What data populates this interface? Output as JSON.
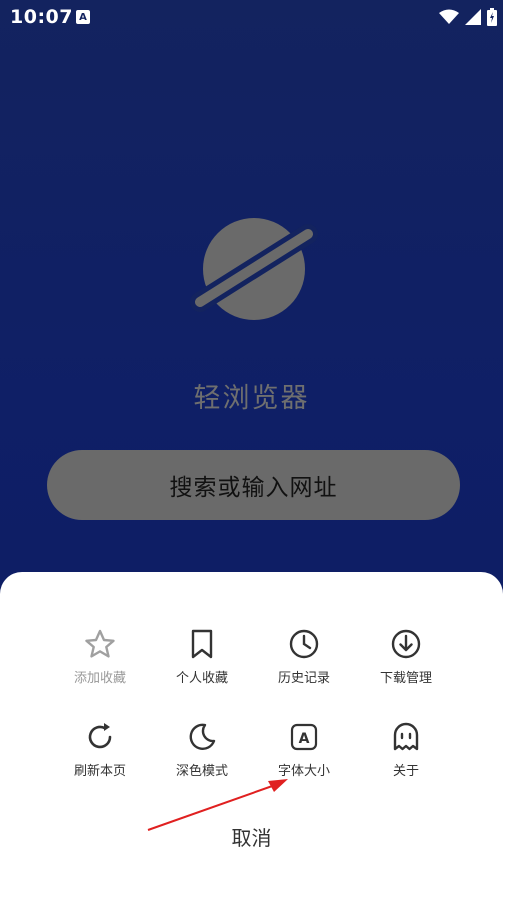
{
  "status_bar": {
    "time": "10:07",
    "notification_glyph": "A"
  },
  "app": {
    "name": "轻浏览器"
  },
  "search": {
    "label": "搜索或输入网址"
  },
  "menu": {
    "items": [
      {
        "label": "添加收藏",
        "icon": "star-icon",
        "enabled": false
      },
      {
        "label": "个人收藏",
        "icon": "bookmark-icon",
        "enabled": true
      },
      {
        "label": "历史记录",
        "icon": "clock-icon",
        "enabled": true
      },
      {
        "label": "下载管理",
        "icon": "download-icon",
        "enabled": true
      },
      {
        "label": "刷新本页",
        "icon": "refresh-icon",
        "enabled": true
      },
      {
        "label": "深色模式",
        "icon": "moon-icon",
        "enabled": true
      },
      {
        "label": "字体大小",
        "icon": "font-size-icon",
        "enabled": true
      },
      {
        "label": "关于",
        "icon": "ghost-icon",
        "enabled": true
      }
    ],
    "cancel_label": "取消",
    "font_icon_glyph": "A"
  },
  "colors": {
    "background": "#0f1f66",
    "sheet": "#ffffff",
    "annotation_arrow": "#e02020"
  }
}
